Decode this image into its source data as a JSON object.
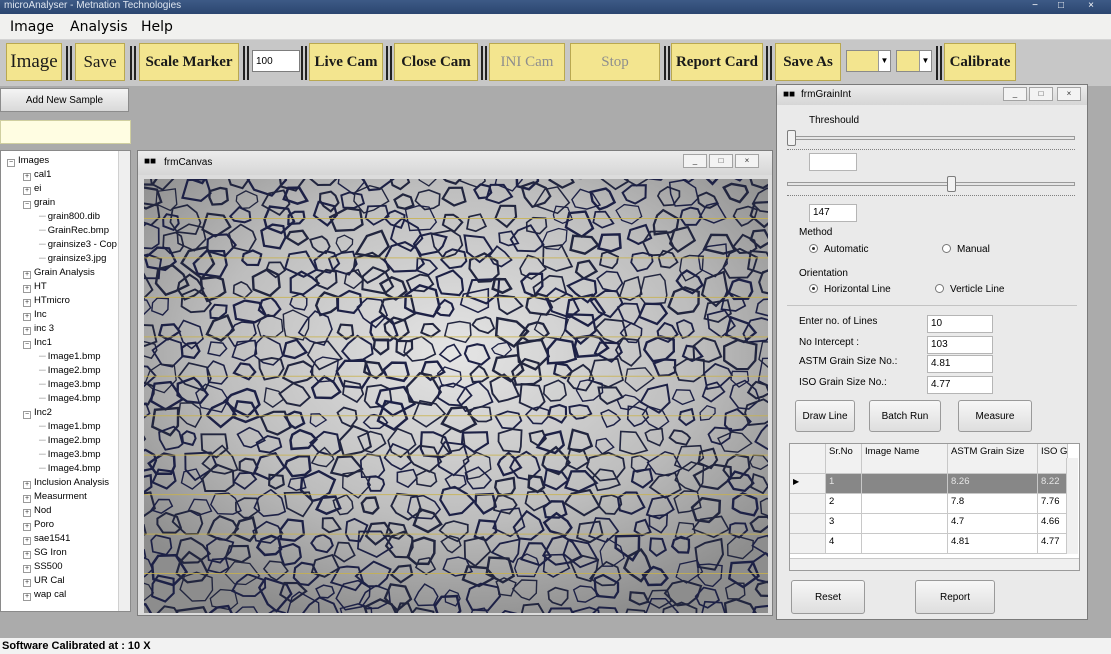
{
  "titlebar": {
    "text": "microAnalyser - Metnation Technologies",
    "controls": [
      "−",
      "□",
      "×"
    ]
  },
  "menu": [
    "Image",
    "Analysis",
    "Help"
  ],
  "toolbar": {
    "image": "Image",
    "save": "Save",
    "scale_marker": "Scale Marker",
    "zoom_value": "100",
    "live_cam": "Live Cam",
    "close_cam": "Close Cam",
    "ini_cam": "INI Cam",
    "stop": "Stop",
    "report_card": "Report Card",
    "save_as": "Save As",
    "calibrate": "Calibrate"
  },
  "sidebar": {
    "add_sample": "Add New Sample",
    "tree": [
      {
        "label": "Images",
        "level": 0,
        "toggle": "−"
      },
      {
        "label": "cal1",
        "level": 1,
        "toggle": "+"
      },
      {
        "label": "ei",
        "level": 1,
        "toggle": "+"
      },
      {
        "label": "grain",
        "level": 1,
        "toggle": "−"
      },
      {
        "label": "grain800.dib",
        "level": 2
      },
      {
        "label": "GrainRec.bmp",
        "level": 2
      },
      {
        "label": "grainsize3 - Cop",
        "level": 2
      },
      {
        "label": "grainsize3.jpg",
        "level": 2
      },
      {
        "label": "Grain Analysis",
        "level": 1,
        "toggle": "+"
      },
      {
        "label": "HT",
        "level": 1,
        "toggle": "+"
      },
      {
        "label": "HTmicro",
        "level": 1,
        "toggle": "+"
      },
      {
        "label": "Inc",
        "level": 1,
        "toggle": "+"
      },
      {
        "label": "inc 3",
        "level": 1,
        "toggle": "+"
      },
      {
        "label": "Inc1",
        "level": 1,
        "toggle": "−"
      },
      {
        "label": "Image1.bmp",
        "level": 2
      },
      {
        "label": "Image2.bmp",
        "level": 2
      },
      {
        "label": "Image3.bmp",
        "level": 2
      },
      {
        "label": "Image4.bmp",
        "level": 2
      },
      {
        "label": "Inc2",
        "level": 1,
        "toggle": "−"
      },
      {
        "label": "Image1.bmp",
        "level": 2
      },
      {
        "label": "Image2.bmp",
        "level": 2
      },
      {
        "label": "Image3.bmp",
        "level": 2
      },
      {
        "label": "Image4.bmp",
        "level": 2
      },
      {
        "label": "Inclusion Analysis",
        "level": 1,
        "toggle": "+"
      },
      {
        "label": "Measurment",
        "level": 1,
        "toggle": "+"
      },
      {
        "label": "Nod",
        "level": 1,
        "toggle": "+"
      },
      {
        "label": "Poro",
        "level": 1,
        "toggle": "+"
      },
      {
        "label": "sae1541",
        "level": 1,
        "toggle": "+"
      },
      {
        "label": "SG Iron",
        "level": 1,
        "toggle": "+"
      },
      {
        "label": "SS500",
        "level": 1,
        "toggle": "+"
      },
      {
        "label": "UR Cal",
        "level": 1,
        "toggle": "+"
      },
      {
        "label": "wap cal",
        "level": 1,
        "toggle": "+"
      }
    ]
  },
  "canvas_window": {
    "title": "frmCanvas"
  },
  "grain_window": {
    "title": "frmGrainInt",
    "threshold_label": "Threshould",
    "threshold_value": "147",
    "method_label": "Method",
    "method_automatic": "Automatic",
    "method_manual": "Manual",
    "orientation_label": "Orientation",
    "orientation_horizontal": "Horizontal Line",
    "orientation_verticle": "Verticle Line",
    "lines_label": "Enter no. of Lines",
    "lines_value": "10",
    "intercept_label": "No Intercept :",
    "intercept_value": "103",
    "astm_label": "ASTM Grain Size No.:",
    "astm_value": "4.81",
    "iso_label": "ISO Grain Size No.:",
    "iso_value": "4.77",
    "draw_line": "Draw Line",
    "batch_run": "Batch Run",
    "measure": "Measure",
    "reset": "Reset",
    "report": "Report",
    "table": {
      "headers": [
        "Sr.No",
        "Image Name",
        "ASTM Grain Size",
        "ISO G Size."
      ],
      "rows": [
        [
          "1",
          "",
          "8.26",
          "8.22"
        ],
        [
          "2",
          "",
          "7.8",
          "7.76"
        ],
        [
          "3",
          "",
          "4.7",
          "4.66"
        ],
        [
          "4",
          "",
          "4.81",
          "4.77"
        ]
      ]
    }
  },
  "status": "Software Calibrated at :  10  X"
}
